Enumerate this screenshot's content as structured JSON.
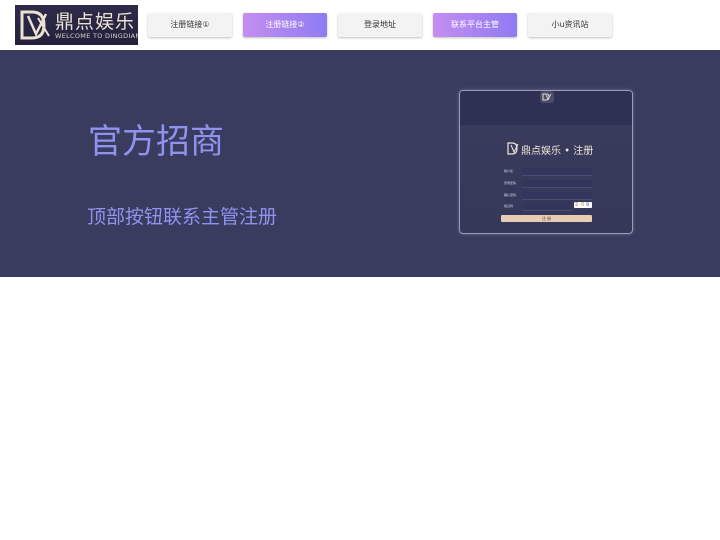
{
  "brand": {
    "name_cn": "鼎点娱乐",
    "tagline_en": "WELCOME TO DINGDIAN"
  },
  "nav": {
    "items": [
      {
        "label": "注册链接①",
        "active": false
      },
      {
        "label": "注册链接②",
        "active": true
      },
      {
        "label": "登录地址",
        "active": false
      },
      {
        "label": "联系平台主管",
        "active": true
      },
      {
        "label": "小u资讯站",
        "active": false
      }
    ]
  },
  "banner": {
    "title": "官方招商",
    "subtitle": "顶部按钮联系主管注册",
    "colors": {
      "background": "#393b5f",
      "text": "#8f93ee"
    }
  },
  "register_preview": {
    "title": "鼎点娱乐 • 注册",
    "fields": [
      {
        "label": "账户名"
      },
      {
        "label": "登录密码"
      },
      {
        "label": "确认密码"
      },
      {
        "label": "验证码"
      }
    ],
    "captcha": "2B9",
    "submit_label": "注 册"
  },
  "colors": {
    "accent_gradient_start": "#c48ef0",
    "accent_gradient_end": "#8f7bf2",
    "button_bg": "#f3f3f3"
  }
}
